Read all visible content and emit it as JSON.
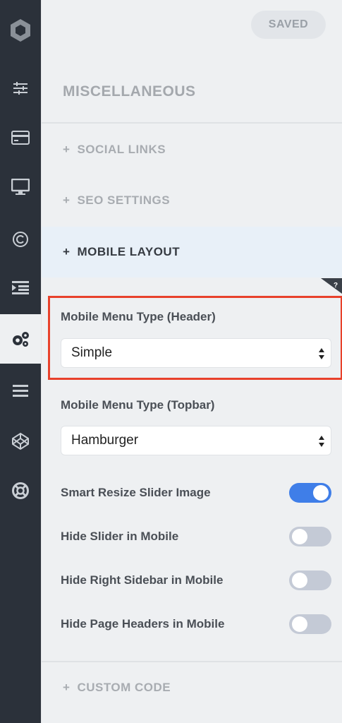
{
  "header": {
    "saved_label": "SAVED"
  },
  "section": {
    "title": "MISCELLANEOUS"
  },
  "accordion": [
    {
      "label": "SOCIAL LINKS",
      "active": false
    },
    {
      "label": "SEO SETTINGS",
      "active": false
    },
    {
      "label": "MOBILE LAYOUT",
      "active": true
    },
    {
      "label": "CUSTOM CODE",
      "active": false
    }
  ],
  "accordion_prefix": "+",
  "help_tab": "?",
  "fields": {
    "header_menu": {
      "label": "Mobile Menu Type (Header)",
      "value": "Simple"
    },
    "topbar_menu": {
      "label": "Mobile Menu Type (Topbar)",
      "value": "Hamburger"
    }
  },
  "toggles": [
    {
      "label": "Smart Resize Slider Image",
      "on": true
    },
    {
      "label": "Hide Slider in Mobile",
      "on": false
    },
    {
      "label": "Hide Right Sidebar in Mobile",
      "on": false
    },
    {
      "label": "Hide Page Headers in Mobile",
      "on": false
    }
  ],
  "sidebar": {
    "items": [
      "logo-icon",
      "sliders-icon",
      "card-icon",
      "monitor-icon",
      "copyright-icon",
      "indent-icon",
      "gears-icon",
      "menu-icon",
      "codepen-icon",
      "lifebuoy-icon"
    ],
    "active": "gears-icon"
  },
  "colors": {
    "accent": "#3f7ee8",
    "highlight": "#e8412b",
    "sidebar_bg": "#2b313a"
  }
}
